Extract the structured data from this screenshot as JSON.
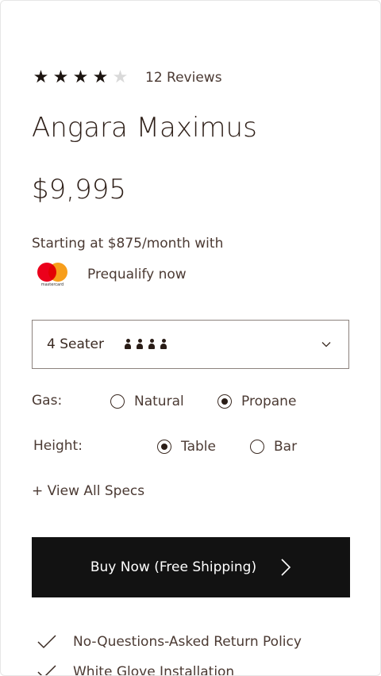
{
  "product": {
    "rating_stars": 4,
    "rating_max": 5,
    "reviews_text": "12 Reviews",
    "title": "Angara Maximus",
    "price": "$9,995",
    "financing_text": "Starting at $875/month with",
    "mastercard_wordmark": "mastercard",
    "prequalify_text": "Prequalify now"
  },
  "seating": {
    "selected": "4 Seater",
    "people_count": 4
  },
  "gas": {
    "label": "Gas:",
    "options": [
      "Natural",
      "Propane"
    ],
    "selected": "Propane"
  },
  "height": {
    "label": "Height:",
    "options": [
      "Table",
      "Bar"
    ],
    "selected": "Table"
  },
  "specs_link": "+ View All Specs",
  "buy_button": "Buy Now (Free Shipping)",
  "policies": [
    "No-Questions-Asked Return Policy",
    "White Glove Installation"
  ],
  "colors": {
    "text": "#3a2a22",
    "button_bg": "#121212",
    "star_filled": "#1c1410",
    "star_empty": "#d9d9d9"
  }
}
